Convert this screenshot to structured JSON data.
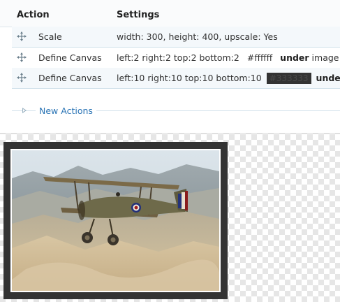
{
  "table": {
    "headers": {
      "action": "Action",
      "settings": "Settings"
    },
    "rows": [
      {
        "action": "Scale",
        "settings": "width: 300, height: 400, upscale: Yes"
      },
      {
        "action": "Define Canvas",
        "settings_prefix": "left:2 right:2 top:2 bottom:2",
        "color": "#ffffff",
        "keyword": "under",
        "suffix": "image"
      },
      {
        "action": "Define Canvas",
        "settings_prefix": "left:10 right:10 top:10 bottom:10",
        "color": "#333333",
        "keyword": "under"
      }
    ]
  },
  "new_actions": {
    "label": "New Actions"
  },
  "preview": {
    "canvas_color": "#333333",
    "inner_border_color": "#ffffff",
    "subject": "biplane-over-hills"
  },
  "icons": {
    "drag_handle": "move-arrows-icon",
    "expand": "triangle-right-icon"
  }
}
